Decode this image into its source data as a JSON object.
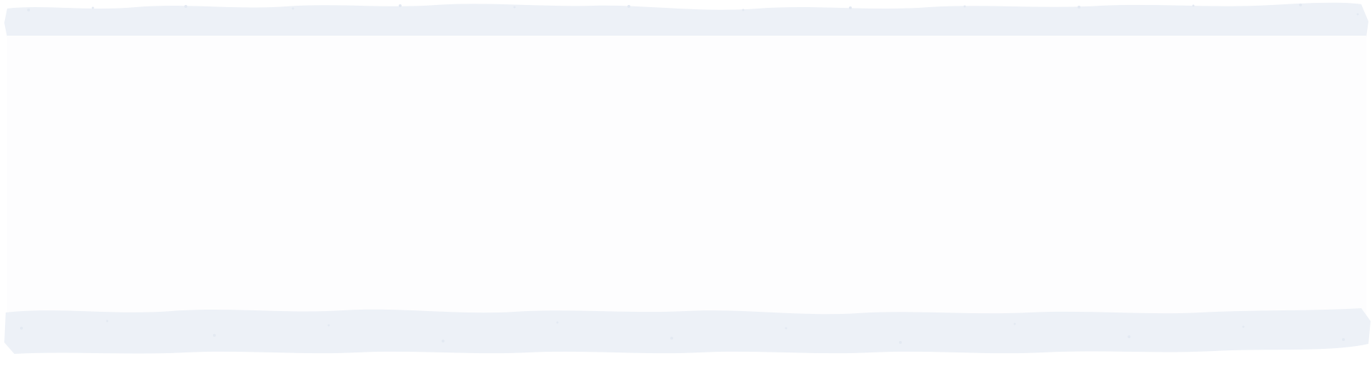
{
  "colors": {
    "background": "#ffffff",
    "panel": "#fdfdfe",
    "brush_stroke": "#edf1f7",
    "brush_speckle": "#e3e9f2"
  }
}
